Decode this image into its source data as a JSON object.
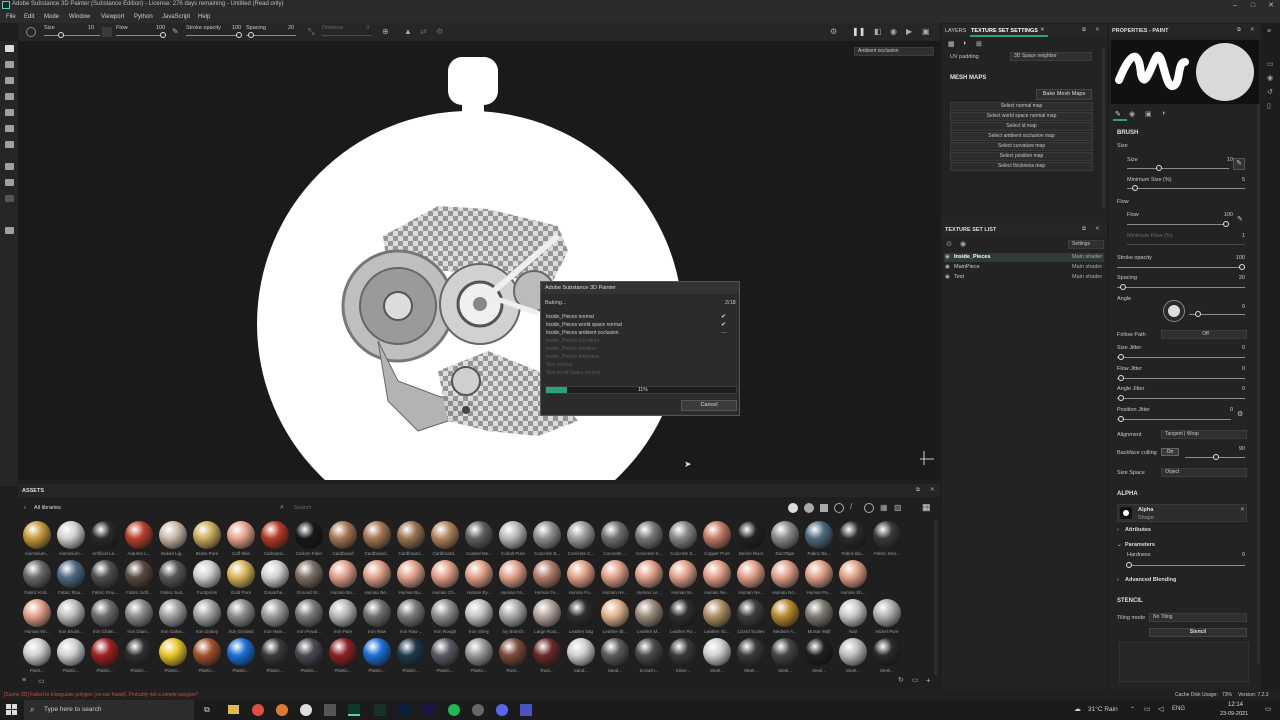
{
  "window": {
    "title": "Adobe Substance 3D Painter (Substance Edition) - License: 276 days remaining - Untitled (Read only)",
    "controls": [
      "–",
      "□",
      "✕"
    ]
  },
  "menu": [
    "File",
    "Edit",
    "Mode",
    "Window",
    "Viewport",
    "Python",
    "JavaScript",
    "Help"
  ],
  "toolbar": {
    "size_label": "Size",
    "size_value": "10",
    "flow_label": "Flow",
    "flow_value": "100",
    "stroke_label": "Stroke opacity",
    "stroke_value": "100",
    "spacing_label": "Spacing",
    "spacing_value": "20",
    "distance_label": "Distance",
    "distance_value": "0"
  },
  "viewport": {
    "mode_select": "Ambient occlusion"
  },
  "bake_dialog": {
    "title": "Adobe Substance 3D Painter",
    "status": "Baking...",
    "counter": "2/18",
    "items": [
      {
        "label": "Inside_Pieces normal",
        "state": "done"
      },
      {
        "label": "Inside_Pieces world space normal",
        "state": "done"
      },
      {
        "label": "Inside_Pieces ambient occlusion",
        "state": "active"
      },
      {
        "label": "Inside_Pieces curvature",
        "state": "pending"
      },
      {
        "label": "Inside_Pieces position",
        "state": "pending"
      },
      {
        "label": "Inside_Pieces thickness",
        "state": "pending"
      },
      {
        "label": "Text normal",
        "state": "pending"
      },
      {
        "label": "Text world space normal",
        "state": "pending"
      }
    ],
    "progress": 0.11,
    "progress_label": "11%",
    "cancel_label": "Cancel"
  },
  "layers_panel": {
    "tab_layers": "LAYERS",
    "tab_tss": "TEXTURE SET SETTINGS",
    "uv_padding_label": "UV padding",
    "uv_padding_value": "3D Space neighbor",
    "mesh_maps_label": "MESH MAPS",
    "bake_button": "Bake Mesh Maps",
    "map_buttons": [
      "Select normal map",
      "Select world space normal map",
      "Select id map",
      "Select ambient occlusion map",
      "Select curvature map",
      "Select position map",
      "Select thickness map"
    ]
  },
  "texture_set_list": {
    "title": "TEXTURE SET LIST",
    "settings": "Settings",
    "rows": [
      {
        "name": "Inside_Pieces",
        "shader": "Main shader"
      },
      {
        "name": "MainPiece",
        "shader": "Main shader"
      },
      {
        "name": "Text",
        "shader": "Main shader"
      }
    ]
  },
  "properties": {
    "title": "PROPERTIES - PAINT",
    "brush_label": "BRUSH",
    "size_group": "Size",
    "size_label": "Size",
    "size_value": "10",
    "min_size_label": "Minimum Size (%)",
    "min_size_value": "5",
    "flow_group": "Flow",
    "flow_label": "Flow",
    "flow_value": "100",
    "min_flow_label": "Minimum Flow (%)",
    "min_flow_value": "1",
    "stroke_label": "Stroke opacity",
    "stroke_value": "100",
    "spacing_label": "Spacing",
    "spacing_value": "20",
    "angle_label": "Angle",
    "angle_value": "0",
    "follow_path_label": "Follow Path",
    "follow_path_value": "Off",
    "size_jitter_label": "Size Jitter",
    "size_jitter_value": "0",
    "flow_jitter_label": "Flow Jitter",
    "flow_jitter_value": "0",
    "angle_jitter_label": "Angle Jitter",
    "angle_jitter_value": "0",
    "position_jitter_label": "Position Jitter",
    "position_jitter_value": "0",
    "alignment_label": "Alignment",
    "alignment_value": "Tangent | Wrap",
    "backface_label": "Backface culling",
    "backface_on": "On",
    "backface_value": "90",
    "size_space_label": "Size Space",
    "size_space_value": "Object",
    "alpha_label": "ALPHA",
    "alpha_name": "Alpha",
    "alpha_sub": "Shape",
    "attributes_label": "Attributes",
    "parameters_label": "Parameters",
    "hardness_label": "Hardness",
    "hardness_value": "0",
    "advanced_label": "Advanced Blending",
    "stencil_label": "STENCIL",
    "tiling_label": "Tiling mode",
    "tiling_value": "No Tiling",
    "stencil_btn": "Stencil"
  },
  "assets": {
    "title": "ASSETS",
    "library": "All libraries",
    "search_placeholder": "Search",
    "rows": [
      [
        {
          "name": "Aluminium...",
          "color": "#c69a3a"
        },
        {
          "name": "Aluminium...",
          "color": "#cfcfcf"
        },
        {
          "name": "Artificial Le...",
          "color": "#2a2a2a"
        },
        {
          "name": "Autumn L...",
          "color": "#b8412c"
        },
        {
          "name": "Baked Lig...",
          "color": "#c9b9a8"
        },
        {
          "name": "Brass Pure",
          "color": "#c9ae5c"
        },
        {
          "name": "Calf Skin",
          "color": "#e7a48b"
        },
        {
          "name": "Carboard...",
          "color": "#b33a26"
        },
        {
          "name": "Carbon Fiber",
          "color": "#181818"
        },
        {
          "name": "Cardboard",
          "color": "#a47653"
        },
        {
          "name": "Cardboard...",
          "color": "#a47653"
        },
        {
          "name": "Cardboard...",
          "color": "#9a7350"
        },
        {
          "name": "Cardboard...",
          "color": "#b08560"
        },
        {
          "name": "Coated Me...",
          "color": "#5f5f5f"
        },
        {
          "name": "Cobalt Pure",
          "color": "#b8b8b8"
        },
        {
          "name": "Concrete B...",
          "color": "#8f8f8f"
        },
        {
          "name": "Concrete C...",
          "color": "#9c9c9c"
        },
        {
          "name": "Concrete ...",
          "color": "#6f6f6f"
        },
        {
          "name": "Concrete S...",
          "color": "#777777"
        },
        {
          "name": "Concrete S...",
          "color": "#868686"
        },
        {
          "name": "Copper Pure",
          "color": "#c27a65"
        },
        {
          "name": "Denim River",
          "color": "#222222"
        },
        {
          "name": "DuctTape",
          "color": "#8a8a8a"
        },
        {
          "name": "Fabric Ba...",
          "color": "#4e6a7d"
        },
        {
          "name": "Fabric Ba...",
          "color": "#2a2a2a"
        },
        {
          "name": "Fabric Den...",
          "color": "#3a3a3a"
        }
      ],
      [
        {
          "name": "Fabric Knit...",
          "color": "#6a6a6a"
        },
        {
          "name": "Fabric Rou...",
          "color": "#4f6a86"
        },
        {
          "name": "Fabric Rou...",
          "color": "#505050"
        },
        {
          "name": "Fabric Soft...",
          "color": "#5a4a40"
        },
        {
          "name": "Fabric Suit...",
          "color": "#585858"
        },
        {
          "name": "Footprints",
          "color": "#cfcfcf"
        },
        {
          "name": "Gold Pure",
          "color": "#d7b45a"
        },
        {
          "name": "Gouache...",
          "color": "#d2d2d2"
        },
        {
          "name": "Ground Gr...",
          "color": "#7c6e62"
        },
        {
          "name": "Human Ba...",
          "color": "#e1a089"
        },
        {
          "name": "Human Be...",
          "color": "#e1a089"
        },
        {
          "name": "Human Bu...",
          "color": "#e1a089"
        },
        {
          "name": "Human Ch...",
          "color": "#e1a089"
        },
        {
          "name": "Human Ey...",
          "color": "#e1a089"
        },
        {
          "name": "Human Fa...",
          "color": "#e1a089"
        },
        {
          "name": "Human Fe...",
          "color": "#b07d6a"
        },
        {
          "name": "Human Fo...",
          "color": "#e1a089"
        },
        {
          "name": "Human He...",
          "color": "#e1a089"
        },
        {
          "name": "Human Le...",
          "color": "#e1a089"
        },
        {
          "name": "Human M...",
          "color": "#e1a089"
        },
        {
          "name": "Human Ne...",
          "color": "#e1a089"
        },
        {
          "name": "Human Ne...",
          "color": "#e1a089"
        },
        {
          "name": "Human No...",
          "color": "#e1a089"
        },
        {
          "name": "Human Pa...",
          "color": "#e1a089"
        },
        {
          "name": "Human Sh...",
          "color": "#e1a089"
        }
      ],
      [
        {
          "name": "Human Wr...",
          "color": "#e1a089"
        },
        {
          "name": "Iron Brush...",
          "color": "#bdbdbd"
        },
        {
          "name": "Iron Chain...",
          "color": "#6d6d6d"
        },
        {
          "name": "Iron Diam...",
          "color": "#8c8c8c"
        },
        {
          "name": "Iron Galva...",
          "color": "#9f9f9f"
        },
        {
          "name": "Iron Grainy",
          "color": "#a4a4a4"
        },
        {
          "name": "Iron Grinded",
          "color": "#8c8c8c"
        },
        {
          "name": "Iron Ham...",
          "color": "#9b9b9b"
        },
        {
          "name": "Iron Powd...",
          "color": "#7a7a7a"
        },
        {
          "name": "Iron Pure",
          "color": "#b8b8b8"
        },
        {
          "name": "Iron Raw",
          "color": "#6f6f6f"
        },
        {
          "name": "Iron Raw ...",
          "color": "#7a7a7a"
        },
        {
          "name": "Iron Rough",
          "color": "#909090"
        },
        {
          "name": "Iron Shiny",
          "color": "#c3c3c3"
        },
        {
          "name": "Ivy Branch",
          "color": "#a9a9a9"
        },
        {
          "name": "Large Rust...",
          "color": "#b3a49a"
        },
        {
          "name": "Leather bag",
          "color": "#2d2d2d"
        },
        {
          "name": "Leather Bl...",
          "color": "#e0b38a"
        },
        {
          "name": "Leather M...",
          "color": "#9b8a7a"
        },
        {
          "name": "Leather Ro...",
          "color": "#2f2f2f"
        },
        {
          "name": "Leather Sc...",
          "color": "#ad8f63"
        },
        {
          "name": "Lizard Scales",
          "color": "#3d3d3d"
        },
        {
          "name": "Medium A...",
          "color": "#b88a2e"
        },
        {
          "name": "Mortar Wall",
          "color": "#7e7a72"
        },
        {
          "name": "Nail",
          "color": "#c8c8c8"
        },
        {
          "name": "Nickel Pure",
          "color": "#b0b0b0"
        }
      ],
      [
        {
          "name": "Paint...",
          "color": "#cfcfcf"
        },
        {
          "name": "Plastic...",
          "color": "#d0d0d0"
        },
        {
          "name": "Plastic...",
          "color": "#a02020"
        },
        {
          "name": "Plastic...",
          "color": "#2f2f2f"
        },
        {
          "name": "Plastic...",
          "color": "#e8c52a"
        },
        {
          "name": "Plastic...",
          "color": "#a0522d"
        },
        {
          "name": "Plastic...",
          "color": "#1a6fd6"
        },
        {
          "name": "Plastic...",
          "color": "#3a3a3a"
        },
        {
          "name": "Plastic...",
          "color": "#4a4a52"
        },
        {
          "name": "Plastic...",
          "color": "#8a2222"
        },
        {
          "name": "Plastic...",
          "color": "#1a6fd6"
        },
        {
          "name": "Plastic...",
          "color": "#1f3a4a"
        },
        {
          "name": "Plastic...",
          "color": "#5a5a66"
        },
        {
          "name": "Plastic...",
          "color": "#999999"
        },
        {
          "name": "Rust...",
          "color": "#7a4a3a"
        },
        {
          "name": "Rust...",
          "color": "#6a2a2a"
        },
        {
          "name": "Sand...",
          "color": "#cfcfcf"
        },
        {
          "name": "Sand...",
          "color": "#5a5a5a"
        },
        {
          "name": "Scratch...",
          "color": "#4a4a4a"
        },
        {
          "name": "Silver...",
          "color": "#3a3a3a"
        },
        {
          "name": "Steel...",
          "color": "#cfcfcf"
        },
        {
          "name": "Steel...",
          "color": "#3a3a3a"
        },
        {
          "name": "Steel...",
          "color": "#444444"
        },
        {
          "name": "Steel...",
          "color": "#1f1f22"
        },
        {
          "name": "Steel...",
          "color": "#bdbdbd"
        },
        {
          "name": "Steel...",
          "color": "#2a2a2a"
        }
      ]
    ]
  },
  "status": {
    "error": "[Scene 3D] Failed to triangulate polygon (no ear found). Probably not a simple polygon?",
    "cache": "Cache Disk Usage:",
    "cache_value": "73%",
    "version": "Version: 7.2.3"
  },
  "taskbar": {
    "search_placeholder": "Type here to search",
    "weather": "31°C Rain",
    "time": "12:14",
    "date": "23-09-2021",
    "lang": "ENG"
  },
  "colors": {
    "accent": "#2ba37f",
    "panel": "#232323",
    "viewport_bg": "#1a1a1a"
  }
}
